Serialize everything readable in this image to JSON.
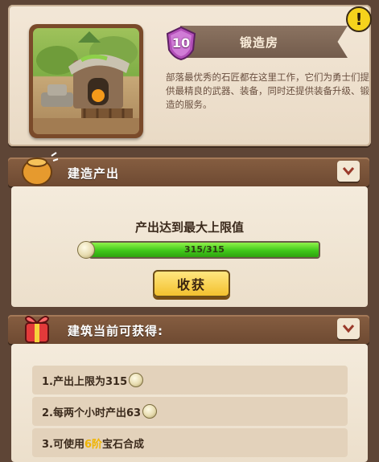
{
  "building": {
    "level": "10",
    "name": "锻造房",
    "description": "部落最优秀的石匠都在这里工作，它们为勇士们提供最精良的武器、装备，同时还提供装备升级、锻造的服务。"
  },
  "production": {
    "section_label": "建造产出",
    "status_text": "产出达到最大上限值",
    "progress_text": "315/315",
    "progress_fraction": 1.0,
    "harvest_label": "收获"
  },
  "rewards": {
    "section_label": "建筑当前可获得:",
    "items": [
      {
        "text": "1.产出上限为315"
      },
      {
        "text": "2.每两个小时产出63"
      },
      {
        "prefix": "3.可使用",
        "highlight": "6阶",
        "suffix": "宝石合成"
      }
    ]
  },
  "colors": {
    "accent_gold": "#f3c12e",
    "progress_green": "#40c81a",
    "level_purple": "#b24fb8"
  },
  "icons": [
    "help-icon",
    "level-shield-icon",
    "pot-icon",
    "gift-icon",
    "collapse-icon",
    "coin-icon"
  ]
}
